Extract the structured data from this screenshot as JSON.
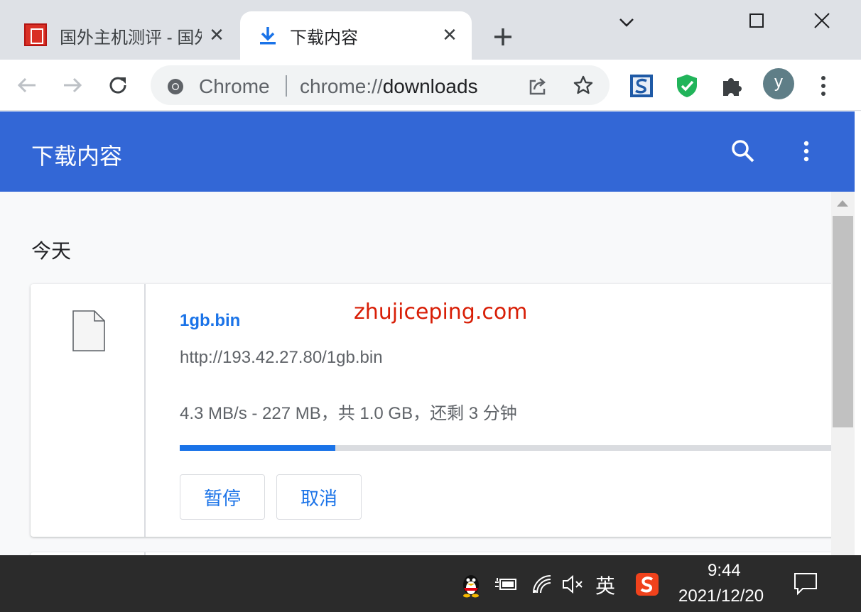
{
  "tabs": [
    {
      "title": "国外主机测评 - 国外",
      "close": "✕",
      "active": false
    },
    {
      "title": "下载内容",
      "close": "✕",
      "active": true
    }
  ],
  "omnibox": {
    "site_chip": "Chrome",
    "url_scheme": "chrome://",
    "url_path": "downloads"
  },
  "profile": {
    "initial": "y"
  },
  "page": {
    "title": "下载内容",
    "day_label": "今天"
  },
  "download": {
    "file_name": "1gb.bin",
    "watermark": "zhujiceping.com",
    "url": "http://193.42.27.80/1gb.bin",
    "status": "4.3 MB/s - 227 MB，共 1.0 GB，还剩 3 分钟",
    "progress_fraction": 0.235,
    "pause_label": "暂停",
    "cancel_label": "取消"
  },
  "taskbar": {
    "ime": "英",
    "time": "9:44",
    "date": "2021/12/20"
  },
  "colors": {
    "accent": "#3367d6",
    "link": "#1a73e8",
    "watermark": "#d81e06",
    "tabstrip": "#dee1e6",
    "taskbar": "#2b2b2b"
  }
}
